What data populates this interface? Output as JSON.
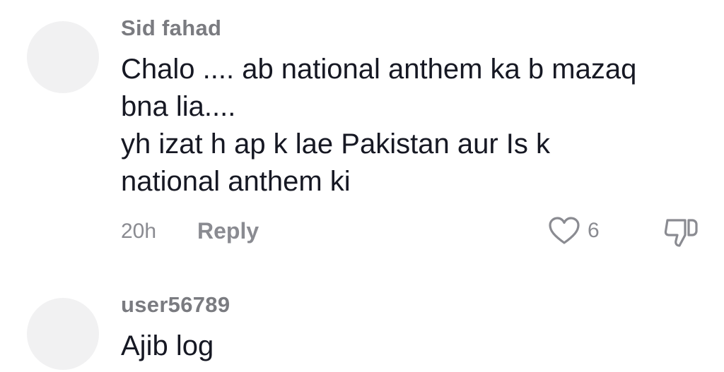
{
  "comments": [
    {
      "username": "Sid fahad",
      "lines": [
        "Chalo .... ab national anthem ka b mazaq",
        "bna lia....",
        "yh izat h ap k lae Pakistan aur Is k",
        "national anthem ki"
      ],
      "time": "20h",
      "reply_label": "Reply",
      "likes": "6",
      "like_icon": "heart-outline-icon",
      "dislike_icon": "thumbs-down-icon"
    },
    {
      "username": "user56789",
      "lines": [
        "Ajib log"
      ]
    }
  ],
  "colors": {
    "text": "#161823",
    "muted": "#8a8b91",
    "avatar_placeholder": "#f1f1f2"
  }
}
